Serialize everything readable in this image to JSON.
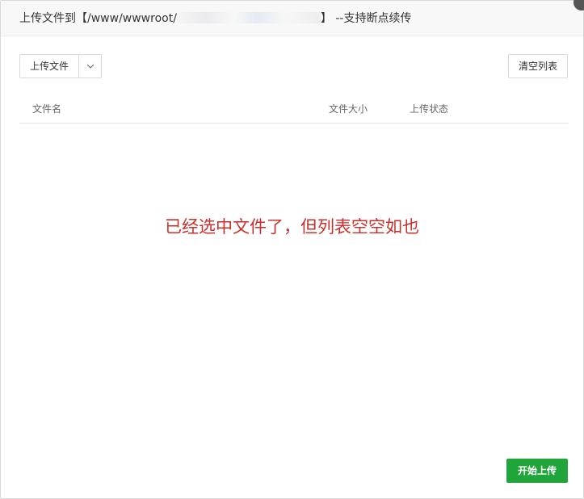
{
  "dialog": {
    "title_prefix": "上传文件到【/www/wwwroot/",
    "title_suffix": "】 --支持断点续传"
  },
  "toolbar": {
    "upload_label": "上传文件",
    "dropdown_icon": "chevron-down-icon",
    "clear_label": "清空列表"
  },
  "table": {
    "columns": [
      "文件名",
      "文件大小",
      "上传状态"
    ],
    "rows": []
  },
  "annotation": {
    "text": "已经选中文件了，但列表空空如也",
    "color": "#c9302c"
  },
  "footer": {
    "start_label": "开始上传"
  },
  "colors": {
    "primary": "#20a53a",
    "annotation": "#c9302c"
  }
}
